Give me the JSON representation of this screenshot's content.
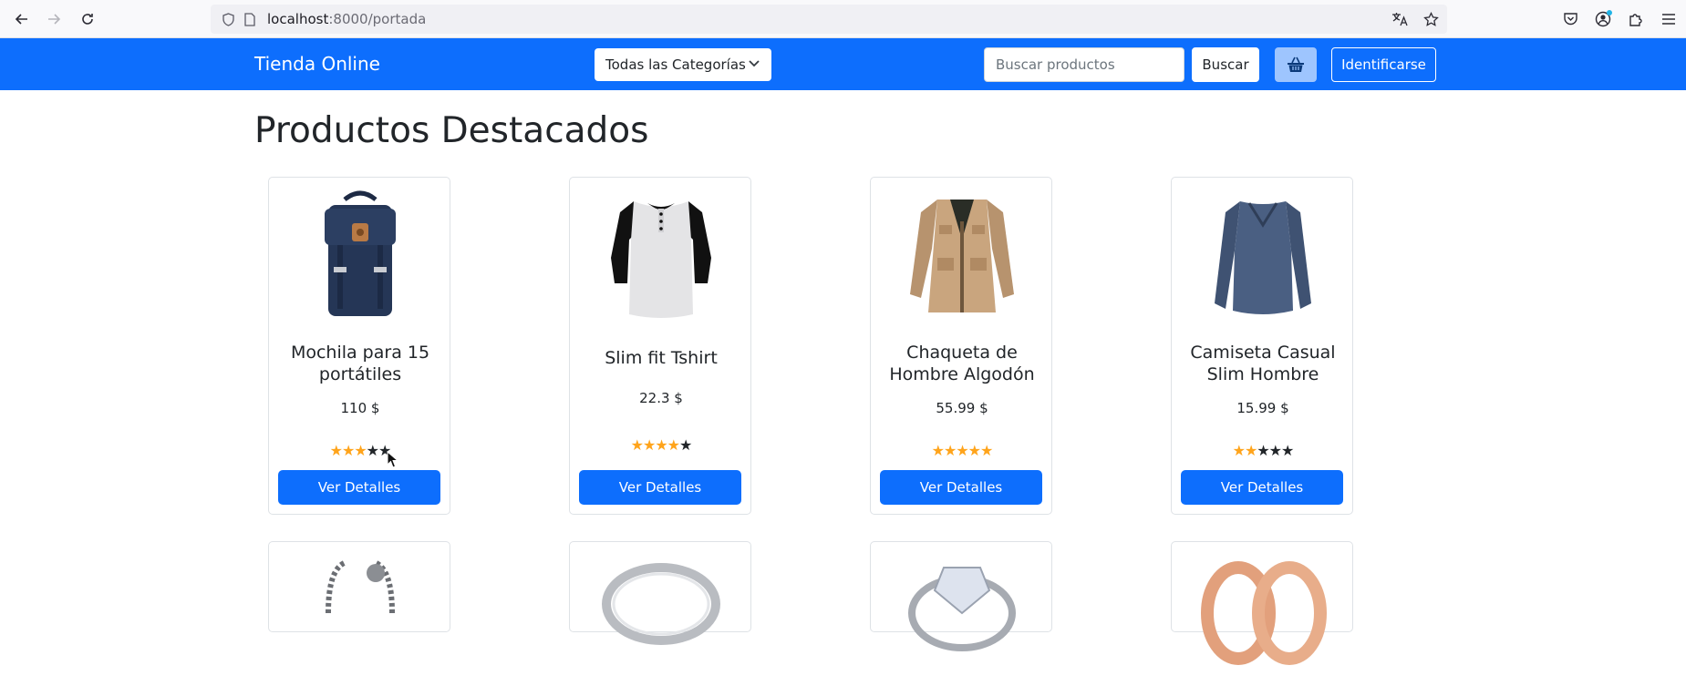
{
  "browser": {
    "url_host": "localhost",
    "url_path": ":8000/portada"
  },
  "navbar": {
    "brand": "Tienda Online",
    "category_select": "Todas las Categorías",
    "search_placeholder": "Buscar productos",
    "search_button": "Buscar",
    "login_button": "Identificarse",
    "colors": {
      "bar": "#0d6efd",
      "cart_button": "#9ec5fe"
    }
  },
  "main": {
    "title": "Productos Destacados",
    "products": [
      {
        "name": "Mochila para 15 portátiles",
        "price": "110 $",
        "rating": 3,
        "button": "Ver Detalles",
        "image_icon": "backpack-image"
      },
      {
        "name": "Slim fit Tshirt",
        "price": "22.3 $",
        "rating": 4,
        "button": "Ver Detalles",
        "image_icon": "tshirt-image"
      },
      {
        "name": "Chaqueta de Hombre Algodón",
        "price": "55.99 $",
        "rating": 5,
        "button": "Ver Detalles",
        "image_icon": "jacket-image"
      },
      {
        "name": "Camiseta Casual Slim Hombre",
        "price": "15.99 $",
        "rating": 2,
        "button": "Ver Detalles",
        "image_icon": "longsleeve-image"
      }
    ],
    "products_row2_icons": [
      "bracelet-image",
      "ring-image",
      "diamond-ring-image",
      "rose-gold-rings-image"
    ],
    "star_colors": {
      "filled": "#ffa41b",
      "empty": "#212529"
    }
  }
}
